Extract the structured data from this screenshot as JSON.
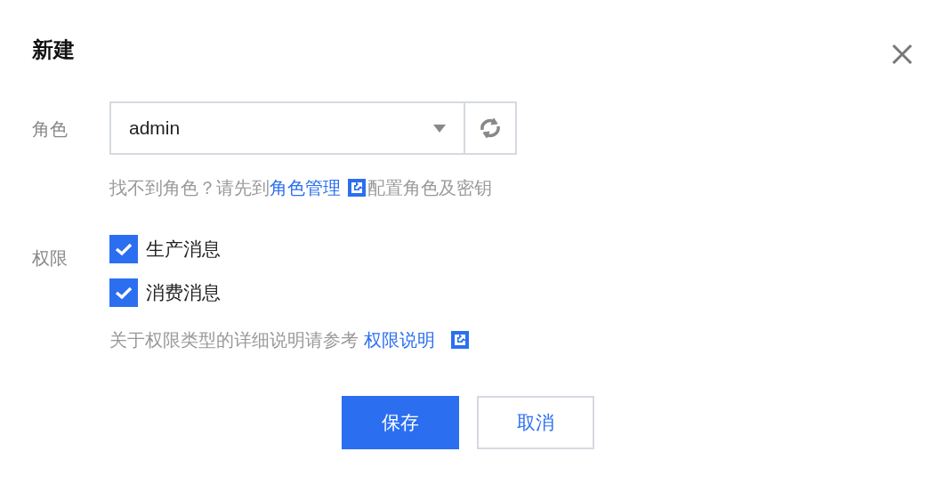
{
  "dialog": {
    "title": "新建",
    "fields": [
      {
        "label": "角色",
        "kind": "select",
        "value": "admin",
        "hint": {
          "before": "找不到角色？请先到",
          "link": "角色管理",
          "after": "配置角色及密钥"
        }
      },
      {
        "label": "权限",
        "kind": "checkboxes",
        "options": [
          {
            "label": "生产消息",
            "checked": true
          },
          {
            "label": "消费消息",
            "checked": true
          }
        ],
        "hint": {
          "before": "关于权限类型的详细说明请参考",
          "link": "权限说明"
        }
      }
    ],
    "buttons": [
      {
        "label": "保存",
        "kind": "primary"
      },
      {
        "label": "取消",
        "kind": "secondary"
      }
    ]
  }
}
